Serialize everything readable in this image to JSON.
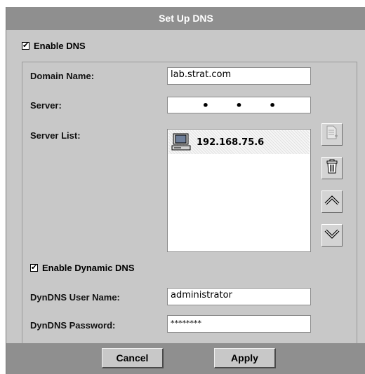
{
  "title": "Set Up DNS",
  "enable_dns": {
    "label": "Enable DNS",
    "checked": true,
    "mark": "✔"
  },
  "domain": {
    "label": "Domain Name:",
    "value": "lab.strat.com"
  },
  "server": {
    "label": "Server:",
    "octets": [
      "•",
      "•",
      "•"
    ]
  },
  "server_list": {
    "label": "Server List:",
    "items": [
      {
        "icon": "computer-icon",
        "text": "192.168.75.6"
      }
    ]
  },
  "side_buttons": [
    {
      "icon": "add-document-icon",
      "enabled": false
    },
    {
      "icon": "trash-icon",
      "enabled": true
    },
    {
      "icon": "chevron-up-icon",
      "enabled": true
    },
    {
      "icon": "chevron-down-icon",
      "enabled": true
    }
  ],
  "enable_dyndns": {
    "label": "Enable Dynamic DNS",
    "checked": true,
    "mark": "✔"
  },
  "dyndns_user": {
    "label": "DynDNS User Name:",
    "value": "administrator"
  },
  "dyndns_password": {
    "label": "DynDNS Password:",
    "value": "********"
  },
  "buttons": {
    "cancel": "Cancel",
    "apply": "Apply"
  }
}
